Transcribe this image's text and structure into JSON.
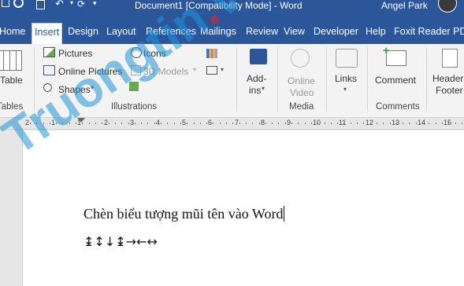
{
  "titlebar": {
    "title": "Document1 [Compatibility Mode]  -  Word",
    "user": "Angel Park"
  },
  "tabs": [
    {
      "label": "Home"
    },
    {
      "label": "Insert"
    },
    {
      "label": "Design"
    },
    {
      "label": "Layout"
    },
    {
      "label": "References"
    },
    {
      "label": "Mailings"
    },
    {
      "label": "Review"
    },
    {
      "label": "View"
    },
    {
      "label": "Developer"
    },
    {
      "label": "Help"
    },
    {
      "label": "Foxit Reader PDF"
    }
  ],
  "active_tab": "Insert",
  "ribbon": {
    "tables": {
      "button": "Table",
      "group": "Tables"
    },
    "illustrations": {
      "pictures": "Pictures",
      "online_pictures": "Online Pictures",
      "shapes": "Shapes",
      "icons": "Icons",
      "models_3d": "3D Models",
      "group": "Illustrations"
    },
    "addins": {
      "line1": "Add-",
      "line2": "ins"
    },
    "media": {
      "line1": "Online",
      "line2": "Video",
      "group": "Media"
    },
    "links": {
      "label": "Links"
    },
    "comments": {
      "label": "Comment",
      "group": "Comments"
    },
    "header": {
      "line1": "Header",
      "line2": "Footer"
    }
  },
  "ruler": {
    "labels": [
      "2",
      "1",
      "1",
      "2",
      "3",
      "4",
      "5",
      "6",
      "7",
      "8",
      "9",
      "10",
      "11",
      "12",
      "13",
      "14",
      "15",
      "16"
    ]
  },
  "document": {
    "line1": "Chèn biểu tượng mũi tên vào Word",
    "line2": "↨↕↓↨→←↔"
  },
  "watermark": {
    "text1": "Truongtin",
    "dot": ".",
    "text2": "vn"
  },
  "colors": {
    "brand": "#2b579a",
    "ribbon_bg": "#f3f3f3",
    "watermark_blue": "#1e96d7",
    "watermark_red": "#e12323"
  }
}
